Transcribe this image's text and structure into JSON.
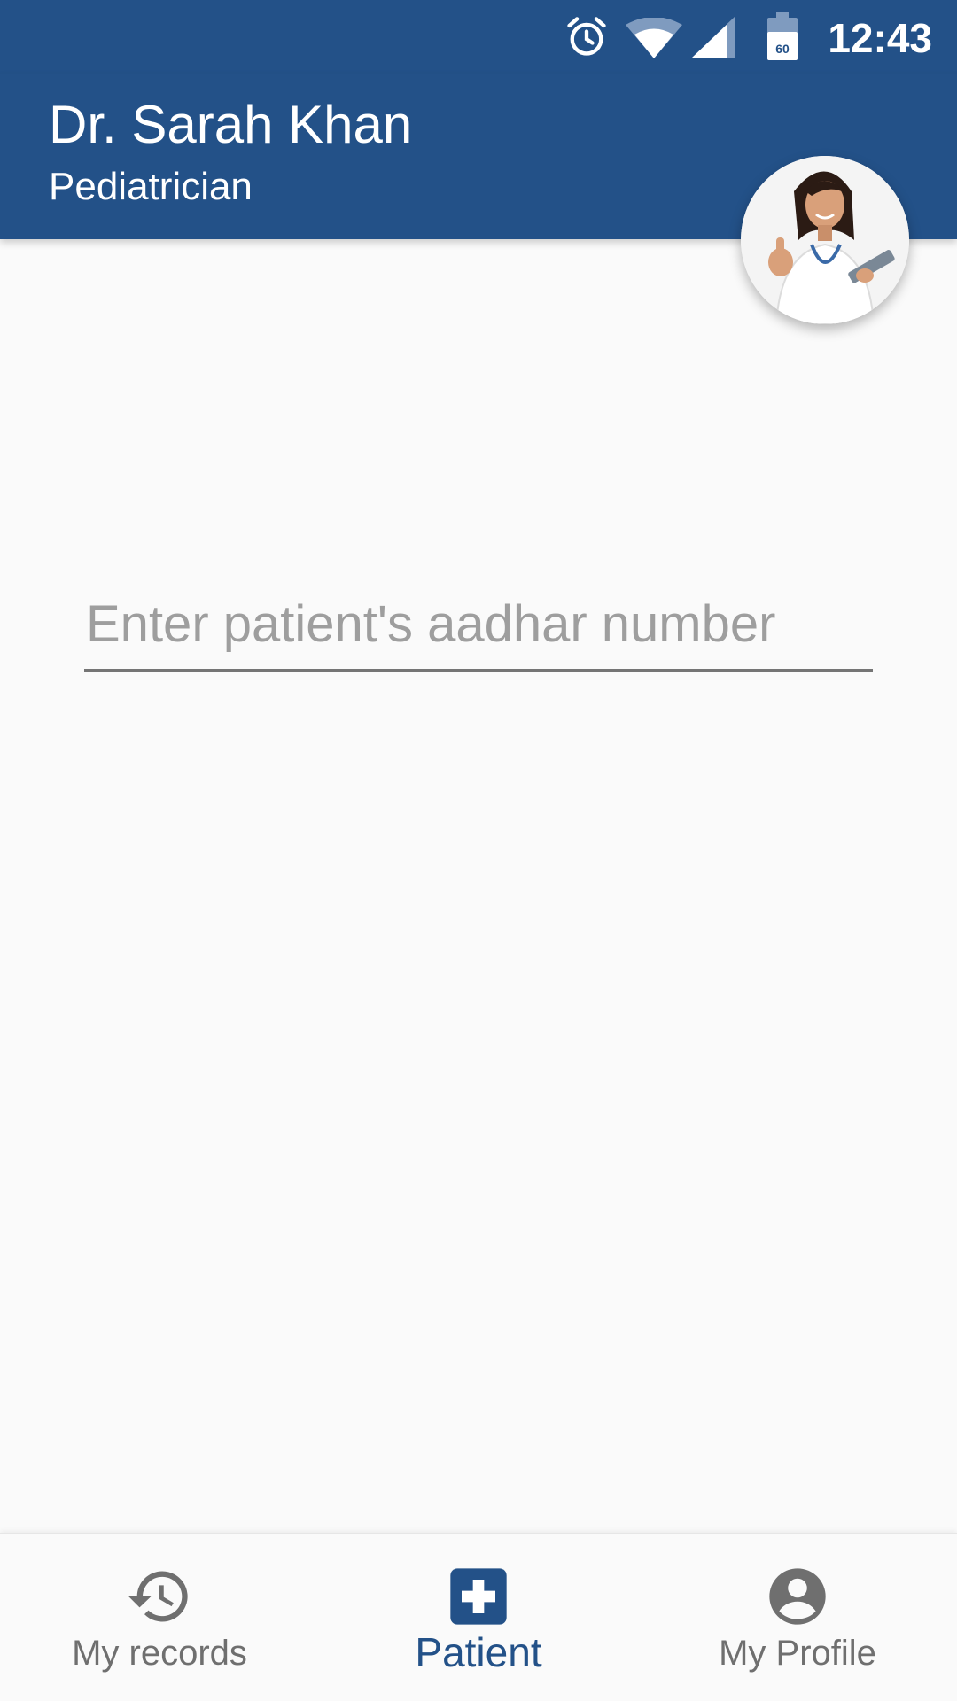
{
  "status_bar": {
    "time": "12:43",
    "battery_level": "60",
    "icons": [
      "alarm-icon",
      "wifi-icon",
      "cell-signal-icon",
      "battery-icon"
    ]
  },
  "header": {
    "name": "Dr. Sarah Khan",
    "role": "Pediatrician"
  },
  "search": {
    "placeholder": "Enter patient's aadhar number",
    "value": ""
  },
  "bottom_nav": {
    "items": [
      {
        "label": "My records",
        "icon": "history-icon",
        "active": false
      },
      {
        "label": "Patient",
        "icon": "medical-cross-icon",
        "active": true
      },
      {
        "label": "My Profile",
        "icon": "account-circle-icon",
        "active": false
      }
    ]
  },
  "colors": {
    "primary": "#235188",
    "background": "#fafafa",
    "inactive": "#6f6f6f"
  }
}
